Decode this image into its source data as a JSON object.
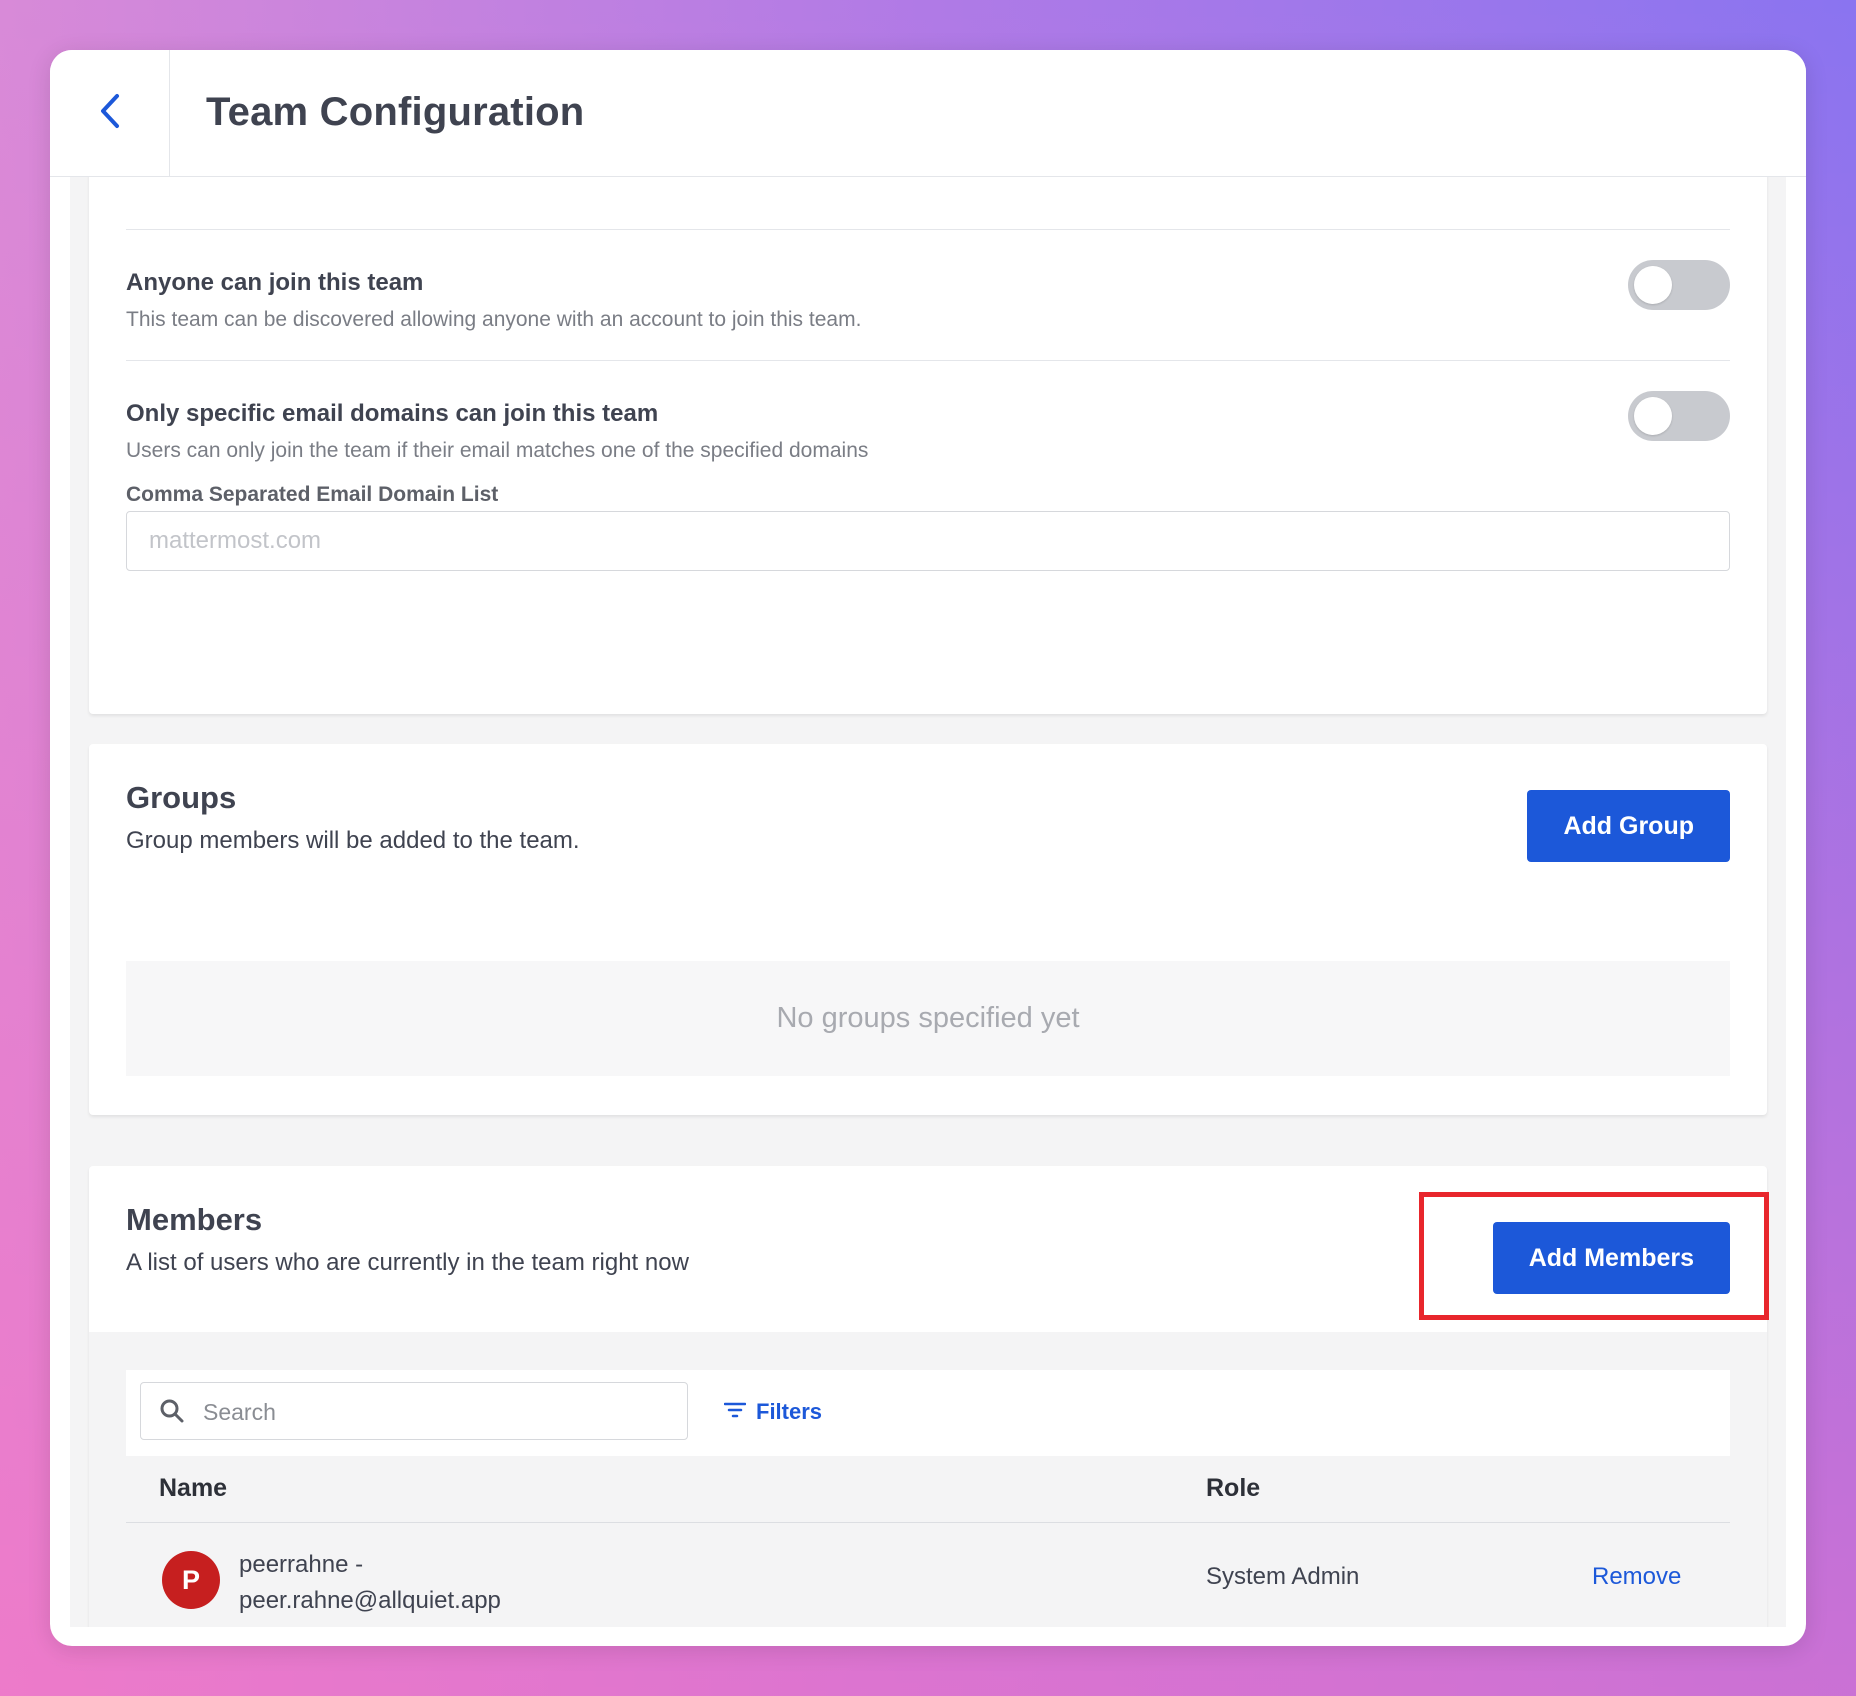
{
  "header": {
    "title": "Team Configuration",
    "back_icon": "chevron-left-icon"
  },
  "access": {
    "anyone_join": {
      "title": "Anyone can join this team",
      "description": "This team can be discovered allowing anyone with an account to join this team.",
      "enabled": false
    },
    "email_domains": {
      "title": "Only specific email domains can join this team",
      "description": "Users can only join the team if their email matches one of the specified domains",
      "enabled": false,
      "field_label": "Comma Separated Email Domain List",
      "field_value": "",
      "field_placeholder": "mattermost.com"
    }
  },
  "groups": {
    "title": "Groups",
    "description": "Group members will be added to the team.",
    "add_button": "Add Group",
    "empty_text": "No groups specified yet"
  },
  "members": {
    "title": "Members",
    "description": "A list of users who are currently in the team right now",
    "add_button": "Add Members",
    "search": {
      "placeholder": "Search",
      "value": "",
      "icon": "search-icon"
    },
    "filters_label": "Filters",
    "columns": [
      "Name",
      "Role"
    ],
    "rows": [
      {
        "initial": "P",
        "name_line1": "peerrahne -",
        "name_line2": "peer.rahne@allquiet.app",
        "role": "System Admin",
        "action": "Remove"
      }
    ]
  },
  "colors": {
    "accent": "#1c58d9",
    "highlight": "#e8262c",
    "avatar": "#c61f1f"
  }
}
